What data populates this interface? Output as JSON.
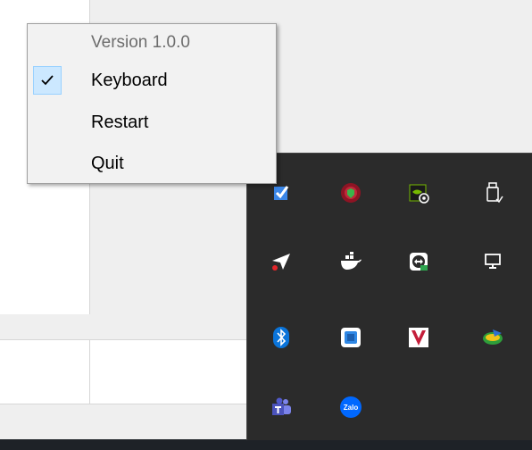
{
  "context_menu": {
    "version_label": "Version 1.0.0",
    "items": [
      {
        "label": "Keyboard",
        "checked": true
      },
      {
        "label": "Restart",
        "checked": false
      },
      {
        "label": "Quit",
        "checked": false
      }
    ]
  },
  "tray_icons": [
    {
      "name": "checkmark-app-icon",
      "color": "#3a86e8"
    },
    {
      "name": "antivirus-shield-icon",
      "color": "#b0182b"
    },
    {
      "name": "nvidia-settings-icon",
      "color": "#76b900"
    },
    {
      "name": "usb-eject-icon",
      "color": "#ffffff"
    },
    {
      "name": "paper-plane-icon",
      "color": "#ffffff"
    },
    {
      "name": "docker-whale-icon",
      "color": "#ffffff"
    },
    {
      "name": "teamviewer-icon",
      "color": "#ffffff"
    },
    {
      "name": "network-monitor-icon",
      "color": "#ffffff"
    },
    {
      "name": "bluetooth-icon",
      "color": "#0a74da"
    },
    {
      "name": "screen-app-icon",
      "color": "#2f88e5"
    },
    {
      "name": "v-app-icon",
      "color": "#c41e3a"
    },
    {
      "name": "download-globe-icon",
      "color": "#2e9e3a"
    },
    {
      "name": "teams-icon",
      "color": "#6264a7"
    },
    {
      "name": "zalo-icon",
      "color": "#0068ff",
      "text": "Zalo"
    }
  ]
}
